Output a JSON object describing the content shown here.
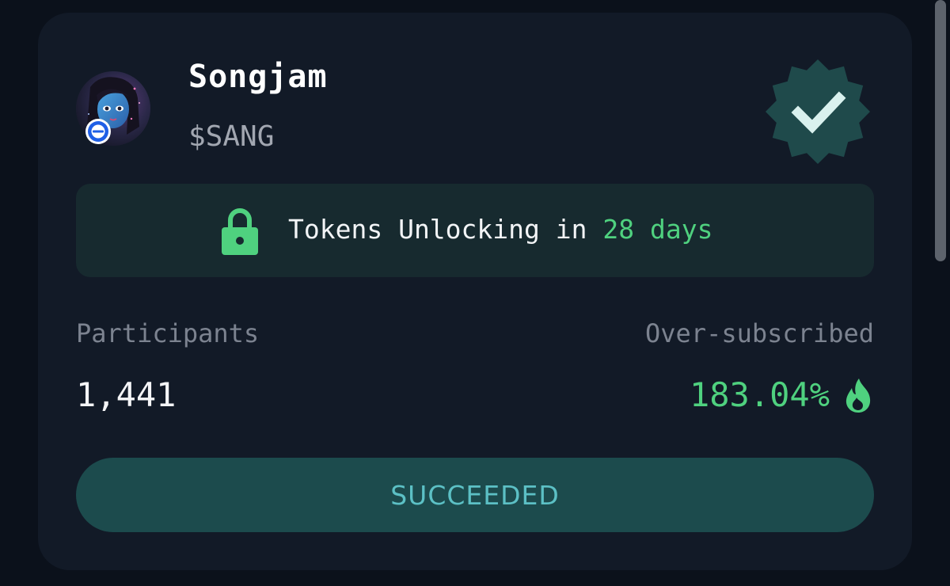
{
  "project": {
    "name": "Songjam",
    "ticker": "$SANG"
  },
  "unlock": {
    "prefix": "Tokens Unlocking in ",
    "duration": "28 days"
  },
  "stats": {
    "participants_label": "Participants",
    "participants_value": "1,441",
    "oversubscribed_label": "Over-subscribed",
    "oversubscribed_value": "183.04%"
  },
  "status": {
    "label": "SUCCEEDED"
  },
  "icons": {
    "avatar": "avatar-image",
    "badge": "chain-badge-icon",
    "verified": "verified-badge-icon",
    "lock": "lock-icon",
    "flame": "flame-icon"
  },
  "colors": {
    "background": "#0b111b",
    "card": "#121a27",
    "accent_green": "#4fd17f",
    "banner": "#172a2f",
    "button": "#1c4b4d",
    "button_text": "#5cc0c5",
    "verified_badge": "#1f4a4b"
  }
}
